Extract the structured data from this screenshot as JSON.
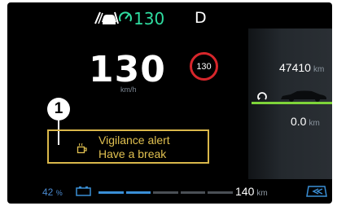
{
  "top_bar": {
    "acc_icon": "adaptive-cruise-control-icon",
    "limiter_icon": "speed-limiter-icon",
    "set_speed": "130",
    "gear": "D",
    "accent_color": "#2fdca0"
  },
  "speedometer": {
    "speed": "130",
    "unit": "km/h"
  },
  "speed_limit_sign": {
    "value": "130",
    "border_color": "#d7262b"
  },
  "callout": {
    "number": "1"
  },
  "alert": {
    "icon": "coffee-cup-icon",
    "line1": "Vigilance alert",
    "line2": "Have a break",
    "color": "#e0c050"
  },
  "odometer": {
    "value": "47410",
    "unit": "km"
  },
  "trip": {
    "value": "0.0",
    "unit": "km",
    "icon": "trip-reset-icon",
    "car_icon": "car-silhouette-icon",
    "bar_color": "#7ed43a"
  },
  "bottom_bar": {
    "battery_percent": "42",
    "percent_sign": "%",
    "battery_icon": "battery-icon",
    "range_value": "140",
    "range_unit": "km",
    "range_fraction": 0.42,
    "regen_icon": "regenerative-braking-icon",
    "accent_color": "#3a8fd6"
  }
}
